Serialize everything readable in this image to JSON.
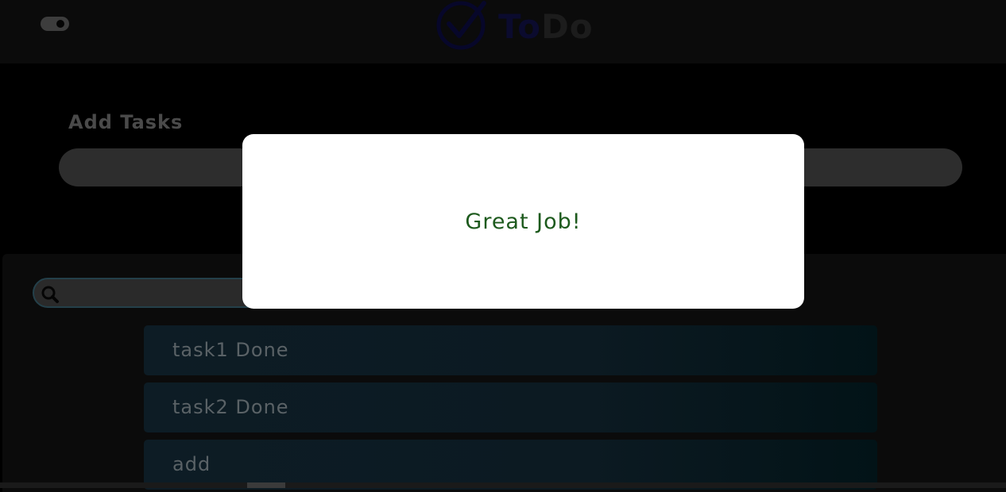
{
  "header": {
    "logo_text_to": "To",
    "logo_text_do": "Do",
    "logo_icon": "check-circle-icon",
    "theme_toggle": "theme-toggle"
  },
  "add": {
    "label": "Add Tasks",
    "input_value": "",
    "input_placeholder": ""
  },
  "search": {
    "icon": "search-icon",
    "value": "",
    "placeholder": ""
  },
  "tasks": [
    {
      "label": "task1 Done"
    },
    {
      "label": "task2 Done"
    },
    {
      "label": "add"
    }
  ],
  "modal": {
    "message": "Great Job!"
  },
  "colors": {
    "modal_text": "#1d5a1d",
    "logo_blue": "#0b0b2e",
    "task_bg": "#0d1c25"
  }
}
